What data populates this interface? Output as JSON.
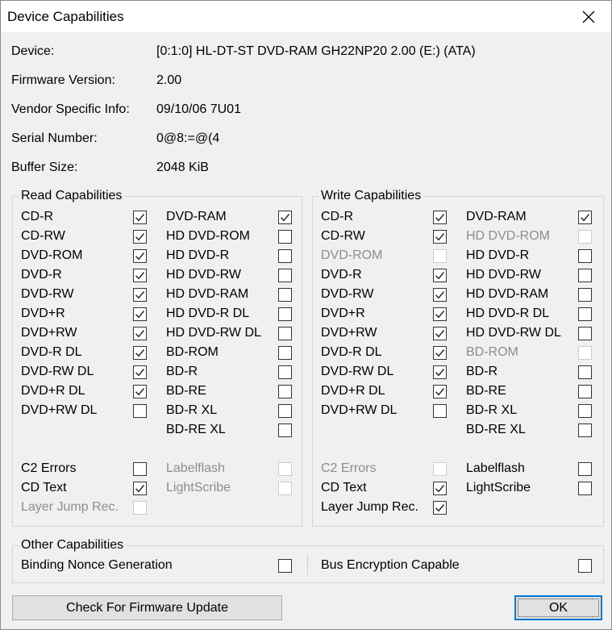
{
  "window": {
    "title": "Device Capabilities"
  },
  "info": [
    {
      "label": "Device:",
      "value": "[0:1:0] HL-DT-ST DVD-RAM GH22NP20 2.00 (E:) (ATA)"
    },
    {
      "label": "Firmware Version:",
      "value": "2.00"
    },
    {
      "label": "Vendor Specific Info:",
      "value": "09/10/06 7U01"
    },
    {
      "label": "Serial Number:",
      "value": "0@8:=@(4"
    },
    {
      "label": "Buffer Size:",
      "value": "2048 KiB"
    }
  ],
  "read_caps": {
    "title": "Read Capabilities",
    "col1": [
      {
        "label": "CD-R",
        "checked": true,
        "enabled": true
      },
      {
        "label": "CD-RW",
        "checked": true,
        "enabled": true
      },
      {
        "label": "DVD-ROM",
        "checked": true,
        "enabled": true
      },
      {
        "label": "DVD-R",
        "checked": true,
        "enabled": true
      },
      {
        "label": "DVD-RW",
        "checked": true,
        "enabled": true
      },
      {
        "label": "DVD+R",
        "checked": true,
        "enabled": true
      },
      {
        "label": "DVD+RW",
        "checked": true,
        "enabled": true
      },
      {
        "label": "DVD-R DL",
        "checked": true,
        "enabled": true
      },
      {
        "label": "DVD-RW DL",
        "checked": true,
        "enabled": true
      },
      {
        "label": "DVD+R DL",
        "checked": true,
        "enabled": true
      },
      {
        "label": "DVD+RW DL",
        "checked": false,
        "enabled": true
      }
    ],
    "col2": [
      {
        "label": "DVD-RAM",
        "checked": true,
        "enabled": true
      },
      {
        "label": "HD DVD-ROM",
        "checked": false,
        "enabled": true
      },
      {
        "label": "HD DVD-R",
        "checked": false,
        "enabled": true
      },
      {
        "label": "HD DVD-RW",
        "checked": false,
        "enabled": true
      },
      {
        "label": "HD DVD-RAM",
        "checked": false,
        "enabled": true
      },
      {
        "label": "HD DVD-R DL",
        "checked": false,
        "enabled": true
      },
      {
        "label": "HD DVD-RW DL",
        "checked": false,
        "enabled": true
      },
      {
        "label": "BD-ROM",
        "checked": false,
        "enabled": true
      },
      {
        "label": "BD-R",
        "checked": false,
        "enabled": true
      },
      {
        "label": "BD-RE",
        "checked": false,
        "enabled": true
      },
      {
        "label": "BD-R XL",
        "checked": false,
        "enabled": true
      },
      {
        "label": "BD-RE XL",
        "checked": false,
        "enabled": true
      }
    ],
    "extra_col1": [
      {
        "label": "C2 Errors",
        "checked": false,
        "enabled": true
      },
      {
        "label": "CD Text",
        "checked": true,
        "enabled": true
      },
      {
        "label": "Layer Jump Rec.",
        "checked": false,
        "enabled": false
      }
    ],
    "extra_col2": [
      {
        "label": "Labelflash",
        "checked": false,
        "enabled": false
      },
      {
        "label": "LightScribe",
        "checked": false,
        "enabled": false
      }
    ]
  },
  "write_caps": {
    "title": "Write Capabilities",
    "col1": [
      {
        "label": "CD-R",
        "checked": true,
        "enabled": true
      },
      {
        "label": "CD-RW",
        "checked": true,
        "enabled": true
      },
      {
        "label": "DVD-ROM",
        "checked": false,
        "enabled": false
      },
      {
        "label": "DVD-R",
        "checked": true,
        "enabled": true
      },
      {
        "label": "DVD-RW",
        "checked": true,
        "enabled": true
      },
      {
        "label": "DVD+R",
        "checked": true,
        "enabled": true
      },
      {
        "label": "DVD+RW",
        "checked": true,
        "enabled": true
      },
      {
        "label": "DVD-R DL",
        "checked": true,
        "enabled": true
      },
      {
        "label": "DVD-RW DL",
        "checked": true,
        "enabled": true
      },
      {
        "label": "DVD+R DL",
        "checked": true,
        "enabled": true
      },
      {
        "label": "DVD+RW DL",
        "checked": false,
        "enabled": true
      }
    ],
    "col2": [
      {
        "label": "DVD-RAM",
        "checked": true,
        "enabled": true
      },
      {
        "label": "HD DVD-ROM",
        "checked": false,
        "enabled": false
      },
      {
        "label": "HD DVD-R",
        "checked": false,
        "enabled": true
      },
      {
        "label": "HD DVD-RW",
        "checked": false,
        "enabled": true
      },
      {
        "label": "HD DVD-RAM",
        "checked": false,
        "enabled": true
      },
      {
        "label": "HD DVD-R DL",
        "checked": false,
        "enabled": true
      },
      {
        "label": "HD DVD-RW DL",
        "checked": false,
        "enabled": true
      },
      {
        "label": "BD-ROM",
        "checked": false,
        "enabled": false
      },
      {
        "label": "BD-R",
        "checked": false,
        "enabled": true
      },
      {
        "label": "BD-RE",
        "checked": false,
        "enabled": true
      },
      {
        "label": "BD-R XL",
        "checked": false,
        "enabled": true
      },
      {
        "label": "BD-RE XL",
        "checked": false,
        "enabled": true
      }
    ],
    "extra_col1": [
      {
        "label": "C2 Errors",
        "checked": false,
        "enabled": false
      },
      {
        "label": "CD Text",
        "checked": true,
        "enabled": true
      },
      {
        "label": "Layer Jump Rec.",
        "checked": true,
        "enabled": true
      }
    ],
    "extra_col2": [
      {
        "label": "Labelflash",
        "checked": false,
        "enabled": true
      },
      {
        "label": "LightScribe",
        "checked": false,
        "enabled": true
      }
    ]
  },
  "other_caps": {
    "title": "Other Capabilities",
    "items": [
      {
        "label": "Binding Nonce Generation",
        "checked": false,
        "enabled": true
      },
      {
        "label": "Bus Encryption Capable",
        "checked": false,
        "enabled": true
      }
    ]
  },
  "buttons": {
    "firmware": "Check For Firmware Update",
    "ok": "OK"
  },
  "colors": {
    "focus_border": "#0078d7",
    "disabled_text": "#8d8d8d"
  }
}
